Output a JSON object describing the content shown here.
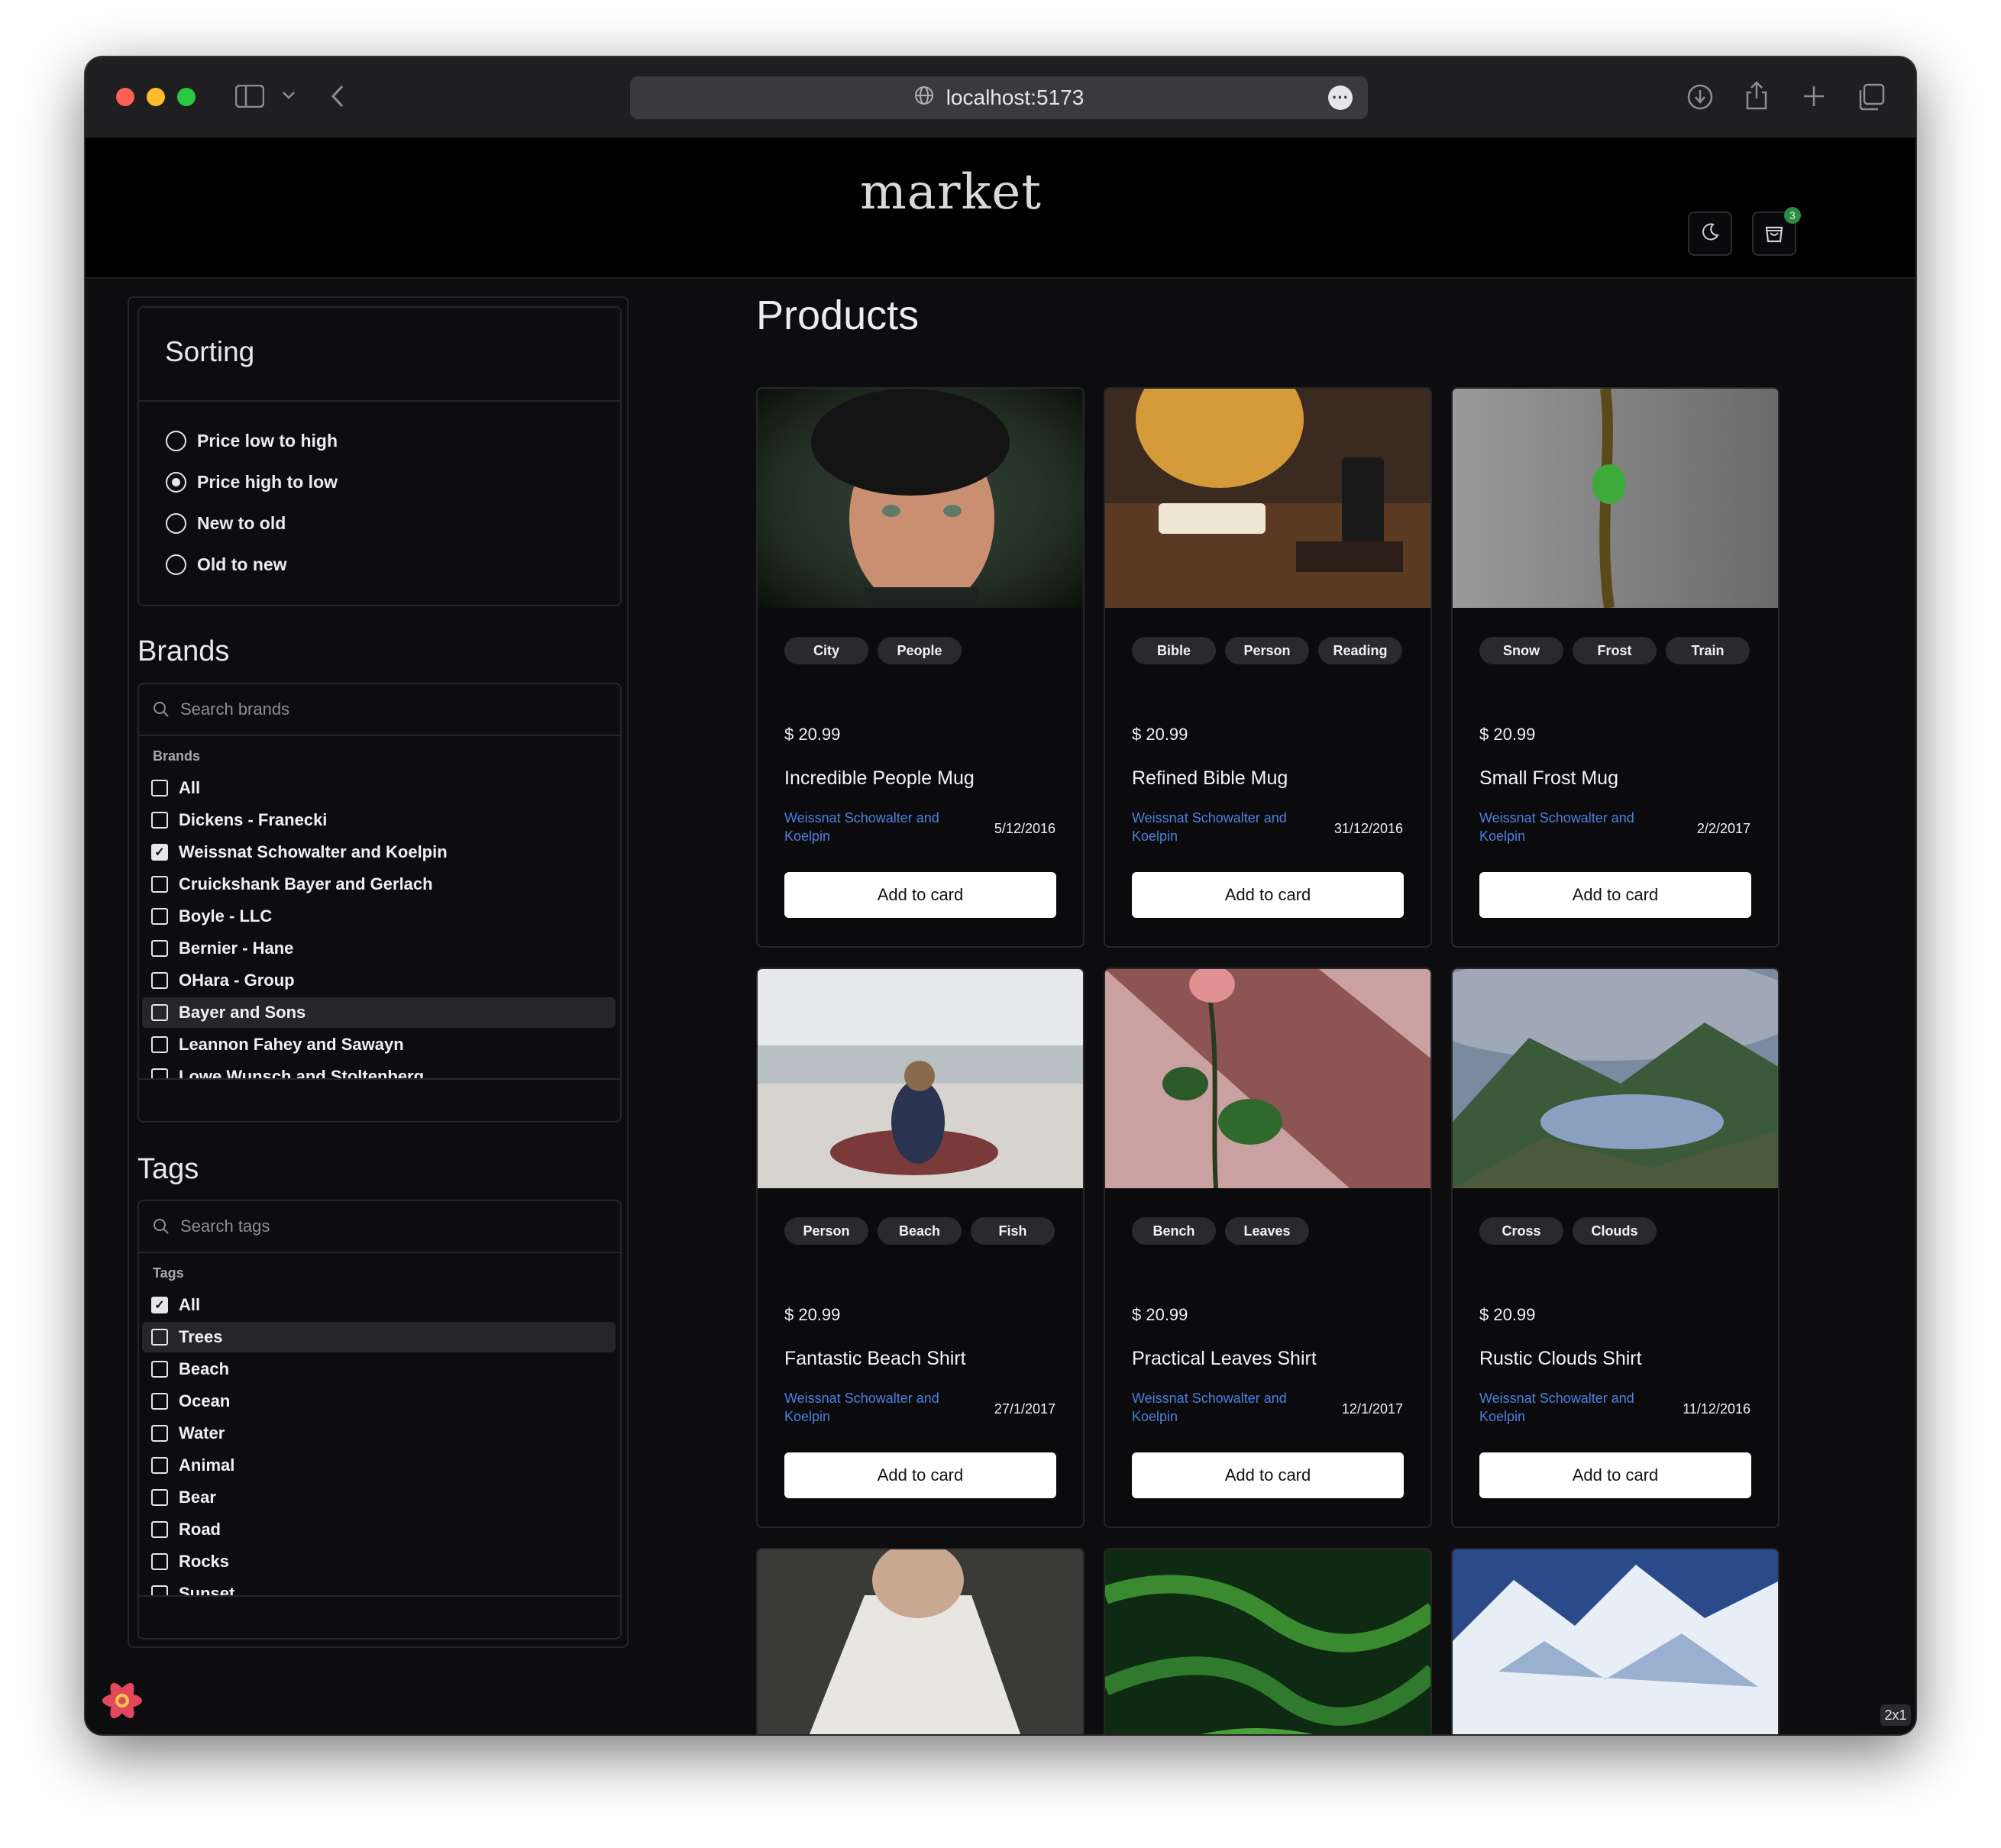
{
  "browser": {
    "url": "localhost:5173",
    "traffic_lights": {
      "close": "#ff5f57",
      "minimize": "#febc2e",
      "zoom": "#28c840"
    }
  },
  "header": {
    "logo": "market",
    "cart_count": "3"
  },
  "sorting": {
    "title": "Sorting",
    "options": [
      {
        "label": "Price low to high",
        "selected": false
      },
      {
        "label": "Price high to low",
        "selected": true
      },
      {
        "label": "New to old",
        "selected": false
      },
      {
        "label": "Old to new",
        "selected": false
      }
    ]
  },
  "brands": {
    "title": "Brands",
    "search_placeholder": "Search brands",
    "list_label": "Brands",
    "items": [
      {
        "label": "All",
        "checked": false
      },
      {
        "label": "Dickens - Franecki",
        "checked": false
      },
      {
        "label": "Weissnat Schowalter and Koelpin",
        "checked": true
      },
      {
        "label": "Cruickshank Bayer and Gerlach",
        "checked": false
      },
      {
        "label": "Boyle - LLC",
        "checked": false
      },
      {
        "label": "Bernier - Hane",
        "checked": false
      },
      {
        "label": "OHara - Group",
        "checked": false
      },
      {
        "label": "Bayer and Sons",
        "checked": false,
        "highlighted": true
      },
      {
        "label": "Leannon Fahey and Sawayn",
        "checked": false
      },
      {
        "label": "Lowe Wunsch and Stoltenberg",
        "checked": false
      }
    ]
  },
  "tags": {
    "title": "Tags",
    "search_placeholder": "Search tags",
    "list_label": "Tags",
    "items": [
      {
        "label": "All",
        "checked": true
      },
      {
        "label": "Trees",
        "checked": false,
        "highlighted": true
      },
      {
        "label": "Beach",
        "checked": false
      },
      {
        "label": "Ocean",
        "checked": false
      },
      {
        "label": "Water",
        "checked": false
      },
      {
        "label": "Animal",
        "checked": false
      },
      {
        "label": "Bear",
        "checked": false
      },
      {
        "label": "Road",
        "checked": false
      },
      {
        "label": "Rocks",
        "checked": false
      },
      {
        "label": "Sunset",
        "checked": false
      }
    ]
  },
  "products": {
    "title": "Products",
    "add_label": "Add to card",
    "items": [
      {
        "tags": [
          "City",
          "People"
        ],
        "price": "$ 20.99",
        "name": "Incredible People Mug",
        "brand": "Weissnat Schowalter and Koelpin",
        "date": "5/12/2016",
        "image": "portrait-young-man"
      },
      {
        "tags": [
          "Bible",
          "Person",
          "Reading"
        ],
        "price": "$ 20.99",
        "name": "Refined Bible Mug",
        "brand": "Weissnat Schowalter and Koelpin",
        "date": "31/12/2016",
        "image": "person-reading-book-with-coffee"
      },
      {
        "tags": [
          "Snow",
          "Frost",
          "Train"
        ],
        "price": "$ 20.99",
        "name": "Small Frost Mug",
        "brand": "Weissnat Schowalter and Koelpin",
        "date": "2/2/2017",
        "image": "green-frog-on-stem"
      },
      {
        "tags": [
          "Person",
          "Beach",
          "Fish"
        ],
        "price": "$ 20.99",
        "name": "Fantastic Beach Shirt",
        "brand": "Weissnat Schowalter and Koelpin",
        "date": "27/1/2017",
        "image": "woman-sitting-on-beach"
      },
      {
        "tags": [
          "Bench",
          "Leaves"
        ],
        "price": "$ 20.99",
        "name": "Practical Leaves Shirt",
        "brand": "Weissnat Schowalter and Koelpin",
        "date": "12/1/2017",
        "image": "rose-in-vase"
      },
      {
        "tags": [
          "Cross",
          "Clouds"
        ],
        "price": "$ 20.99",
        "name": "Rustic Clouds Shirt",
        "brand": "Weissnat Schowalter and Koelpin",
        "date": "11/12/2016",
        "image": "mountain-lake-clouds"
      },
      {
        "image": "person-white-shirt"
      },
      {
        "image": "fern-leaves"
      },
      {
        "image": "snowy-mountains-aerial"
      }
    ]
  },
  "overlay": {
    "zoom_badge": "2x1"
  }
}
